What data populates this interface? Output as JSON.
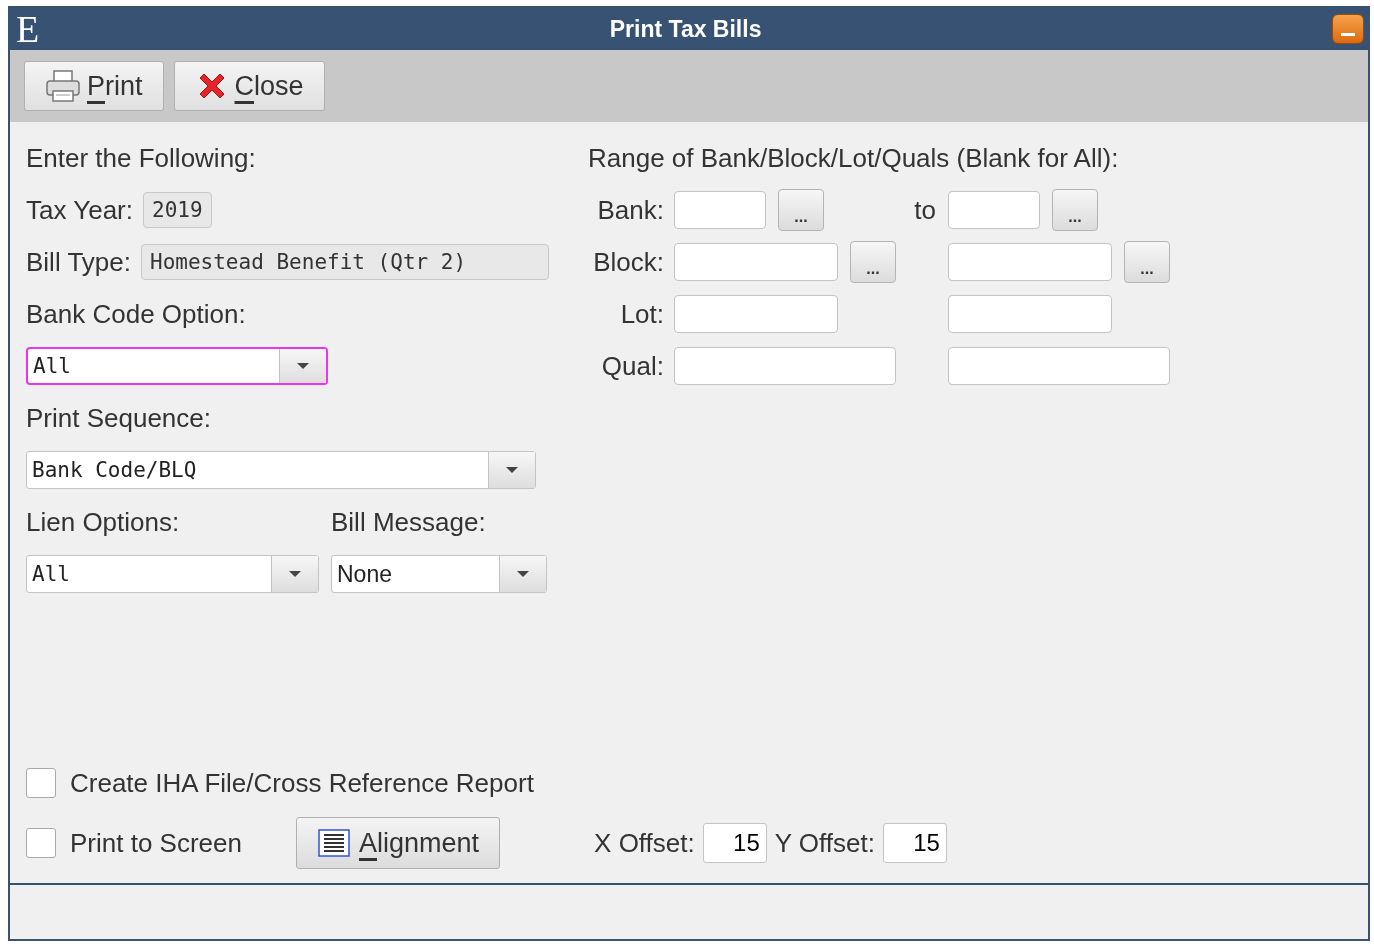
{
  "window": {
    "logo": "E",
    "title": "Print Tax Bills"
  },
  "toolbar": {
    "buttons": [
      {
        "kind": "print",
        "label": "Print"
      },
      {
        "kind": "close",
        "label": "Close"
      }
    ]
  },
  "form": {
    "heading": "Enter the Following:",
    "tax_year": {
      "label": "Tax Year:",
      "value": "2019"
    },
    "bill_type": {
      "label": "Bill Type:",
      "value": "Homestead Benefit (Qtr 2)"
    },
    "bank_code_option": {
      "label": "Bank Code Option:",
      "value": "All",
      "focused": true
    },
    "print_sequence": {
      "label": "Print Sequence:",
      "value": "Bank Code/BLQ",
      "focused": false
    },
    "lien_options": {
      "label": "Lien Options:",
      "value": "All",
      "focused": false
    },
    "bill_message": {
      "label": "Bill Message:",
      "value": "None",
      "focused": false
    }
  },
  "range": {
    "heading": "Range of Bank/Block/Lot/Quals (Blank for All):",
    "rows": [
      {
        "label": "Bank:",
        "kind": "short",
        "to_label": "to",
        "buttons": [
          "...",
          "..."
        ]
      },
      {
        "label": "Block:",
        "kind": "medium",
        "buttons": [
          "...",
          "..."
        ]
      },
      {
        "label": "Lot:",
        "kind": "medium"
      },
      {
        "label": "Qual:",
        "kind": "long"
      }
    ]
  },
  "options": {
    "checkboxes": [
      {
        "label": "Create IHA File/Cross Reference Report",
        "checked": false
      },
      {
        "label": "Print to Screen",
        "checked": false
      }
    ],
    "alignment_button": "Alignment",
    "x_offset": {
      "label": "X Offset:",
      "value": "15"
    },
    "y_offset": {
      "label": "Y Offset:",
      "value": "15"
    }
  }
}
